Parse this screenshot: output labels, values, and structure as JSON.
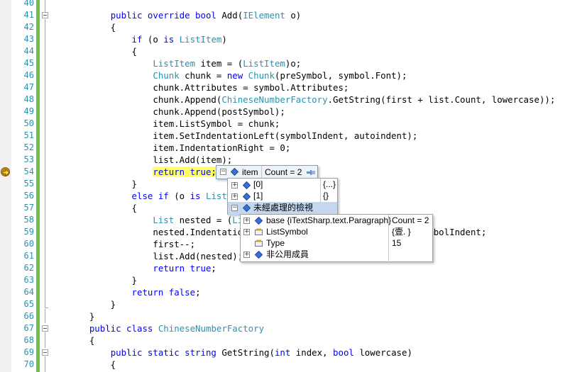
{
  "editor": {
    "lines": [
      {
        "n": "40",
        "text": ""
      },
      {
        "n": "41",
        "text": "        <kw>public override bool</kw> Add(<ty>IElement</ty> o)"
      },
      {
        "n": "42",
        "text": "        {"
      },
      {
        "n": "43",
        "text": "            <kw>if</kw> (o <kw>is</kw> <ty>ListItem</ty>)"
      },
      {
        "n": "44",
        "text": "            {"
      },
      {
        "n": "45",
        "text": "                <ty>ListItem</ty> item = (<ty>ListItem</ty>)o;"
      },
      {
        "n": "46",
        "text": "                <ty>Chunk</ty> chunk = <kw>new</kw> <ty>Chunk</ty>(preSymbol, symbol.Font);"
      },
      {
        "n": "47",
        "text": "                chunk.Attributes = symbol.Attributes;"
      },
      {
        "n": "48",
        "text": "                chunk.Append(<ty>ChineseNumberFactory</ty>.GetString(first + list.Count, lowercase));"
      },
      {
        "n": "49",
        "text": "                chunk.Append(postSymbol);"
      },
      {
        "n": "50",
        "text": "                item.ListSymbol = chunk;"
      },
      {
        "n": "51",
        "text": "                item.SetIndentationLeft(symbolIndent, autoindent);"
      },
      {
        "n": "52",
        "text": "                item.IndentationRight = 0;"
      },
      {
        "n": "53",
        "text": "                list.Add(item);"
      },
      {
        "n": "54",
        "text": "                <hl><kw>return true</kw>;</hl>"
      },
      {
        "n": "55",
        "text": "            }"
      },
      {
        "n": "56",
        "text": "            <kw>else if</kw> (o <kw>is</kw> <ty>List</ty>)"
      },
      {
        "n": "57",
        "text": "            {"
      },
      {
        "n": "58",
        "text": "                <ty>List</ty> nested = (<ty>List</ty>)o;"
      },
      {
        "n": "59",
        "text": "                nested.IndentationLeft = nested.IndentationLeft + symbolIndent;"
      },
      {
        "n": "60",
        "text": "                first--;"
      },
      {
        "n": "61",
        "text": "                list.Add(nested);"
      },
      {
        "n": "62",
        "text": "                <kw>return true</kw>;"
      },
      {
        "n": "63",
        "text": "            }"
      },
      {
        "n": "64",
        "text": "            <kw>return false</kw>;"
      },
      {
        "n": "65",
        "text": "        }"
      },
      {
        "n": "66",
        "text": "    }"
      },
      {
        "n": "67",
        "text": "    <kw>public class</kw> <ty>ChineseNumberFactory</ty>"
      },
      {
        "n": "68",
        "text": "    {"
      },
      {
        "n": "69",
        "text": "        <kw>public static string</kw> GetString(<kw>int</kw> index, <kw>bool</kw> lowercase)"
      },
      {
        "n": "70",
        "text": "        {"
      }
    ]
  },
  "datatip": {
    "name": "item",
    "value": "Count = 2",
    "children": [
      {
        "name": "[0]",
        "value": "{...}"
      },
      {
        "name": "[1]",
        "value": "{}"
      },
      {
        "name": "未經處理的檢視",
        "value": ""
      }
    ],
    "raw_view": [
      {
        "name": "base {iTextSharp.text.Paragraph}",
        "value": "Count = 2"
      },
      {
        "name": "ListSymbol",
        "value": "{壹. }"
      },
      {
        "name": "Type",
        "value": "15"
      },
      {
        "name": "非公用成員",
        "value": ""
      }
    ]
  },
  "colors": {
    "keyword": "#0000ff",
    "type": "#2b91af",
    "line_number": "#2b91af",
    "current_statement": "#ffff66",
    "change_bar": "#6cc24a"
  }
}
